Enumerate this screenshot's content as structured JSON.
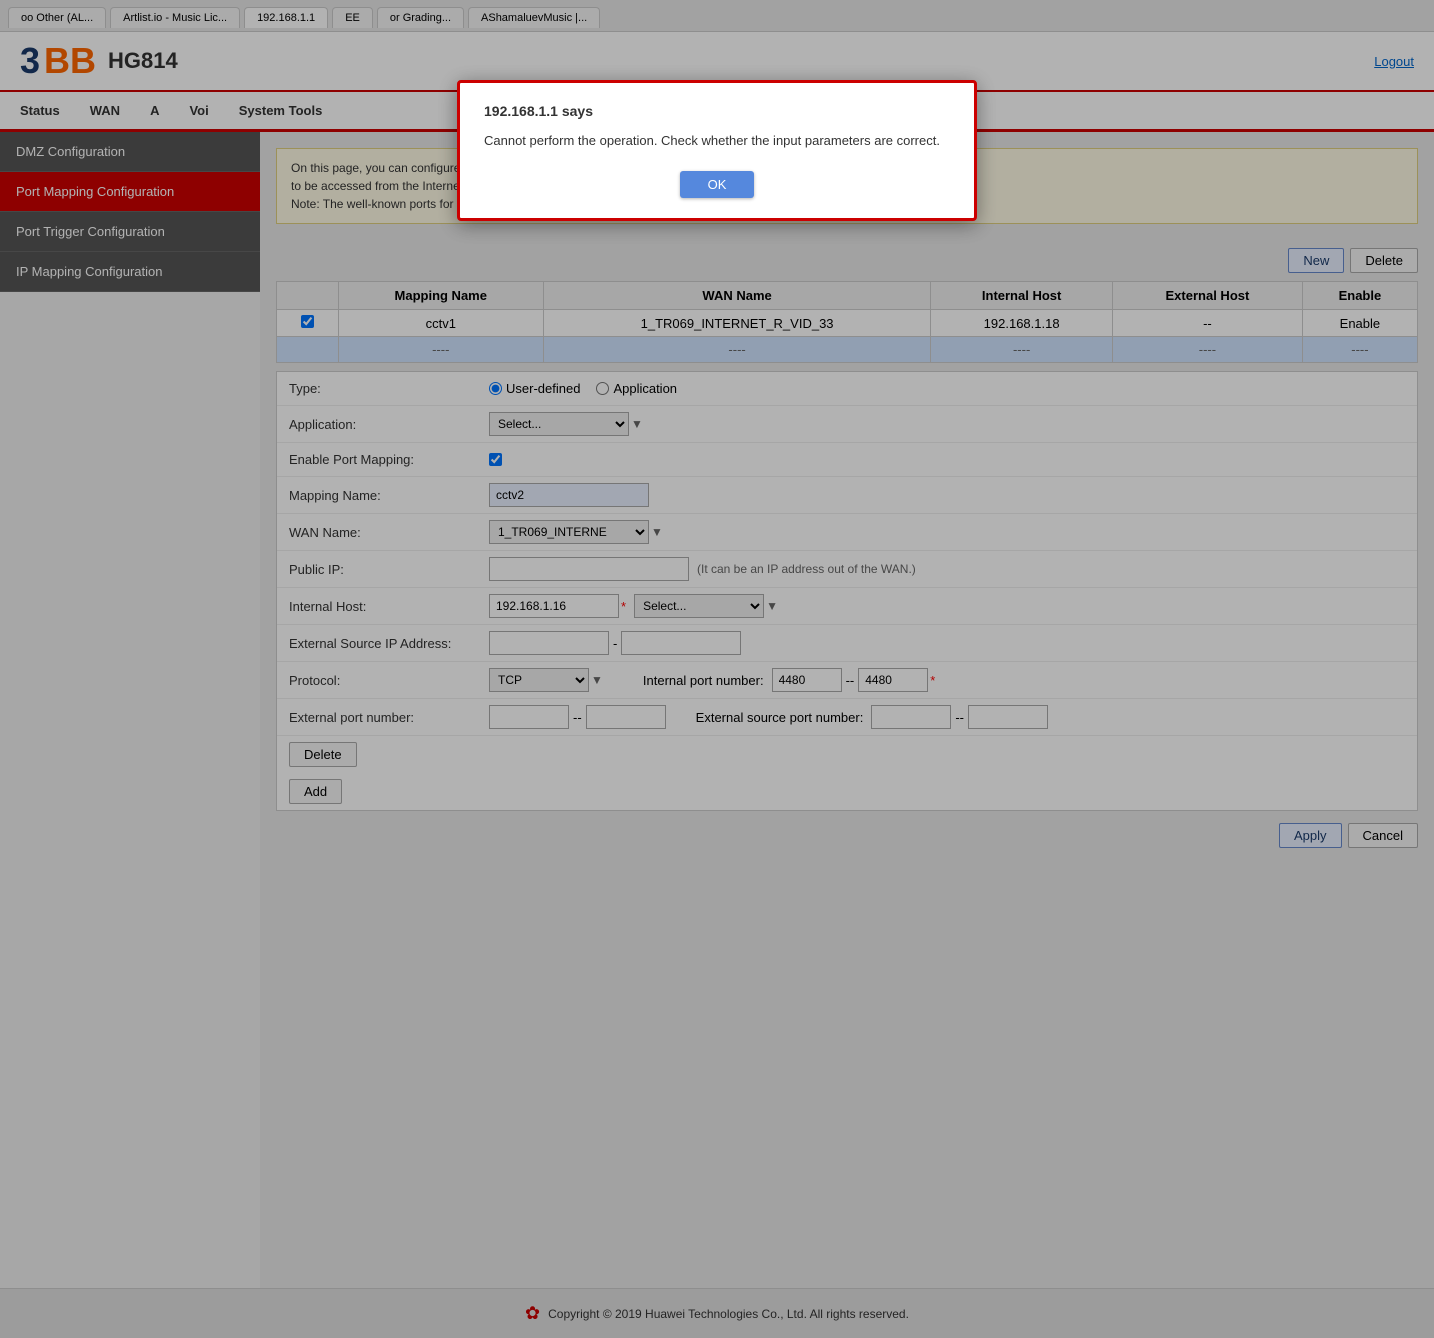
{
  "browser": {
    "tabs": [
      {
        "label": "oo Other (AL...",
        "active": false
      },
      {
        "label": "Artlist.io - Music Lic...",
        "active": false
      },
      {
        "label": "EE",
        "active": false
      },
      {
        "label": "or Grading...",
        "active": false
      },
      {
        "label": "AShamaluevMusic |...",
        "active": false
      }
    ]
  },
  "header": {
    "logo_number": "3",
    "logo_bb": "BB",
    "model": "HG814",
    "logout_label": "Logout"
  },
  "nav": {
    "items": [
      "Status",
      "WAN",
      "A",
      "Voi",
      "System Tools"
    ]
  },
  "sidebar": {
    "items": [
      {
        "label": "DMZ Configuration",
        "active": false
      },
      {
        "label": "Port Mapping Configuration",
        "active": true
      },
      {
        "label": "Port Trigger Configuration",
        "active": false
      },
      {
        "label": "IP Mapping Configuration",
        "active": false
      }
    ]
  },
  "info_box": {
    "line1": "On this page, you can configure port mapping parameters to set up virtual servers on the LAN network and allow these servers",
    "line2": "to be accessed from the Internet.",
    "line3": "Note: The well-known ports for voice services cannot be in the range of the mapping ports."
  },
  "toolbar": {
    "new_label": "New",
    "delete_label": "Delete"
  },
  "table": {
    "headers": [
      "",
      "Mapping Name",
      "WAN Name",
      "Internal Host",
      "External Host",
      "Enable"
    ],
    "rows": [
      {
        "checked": true,
        "mapping_name": "cctv1",
        "wan_name": "1_TR069_INTERNET_R_VID_33",
        "internal_host": "192.168.1.18",
        "external_host": "--",
        "enable": "Enable"
      },
      {
        "checked": false,
        "mapping_name": "----",
        "wan_name": "----",
        "internal_host": "----",
        "external_host": "----",
        "enable": "----",
        "empty": true
      }
    ]
  },
  "form": {
    "type_label": "Type:",
    "type_user_defined": "User-defined",
    "type_application": "Application",
    "application_label": "Application:",
    "application_placeholder": "Select...",
    "enable_label": "Enable Port Mapping:",
    "mapping_name_label": "Mapping Name:",
    "mapping_name_value": "cctv2",
    "wan_name_label": "WAN Name:",
    "wan_name_value": "1_TR069_INTERNE",
    "public_ip_label": "Public IP:",
    "public_ip_hint": "(It can be an IP address out of the WAN.)",
    "internal_host_label": "Internal Host:",
    "internal_host_value": "192.168.1.16",
    "internal_host_select": "Select...",
    "ext_source_ip_label": "External Source IP Address:",
    "protocol_label": "Protocol:",
    "protocol_value": "TCP",
    "internal_port_label": "Internal port number:",
    "internal_port_from": "4480",
    "internal_port_to": "4480",
    "ext_port_label": "External port number:",
    "ext_source_port_label": "External source port number:",
    "delete_btn": "Delete",
    "add_btn": "Add",
    "apply_btn": "Apply",
    "cancel_btn": "Cancel"
  },
  "dialog": {
    "title": "192.168.1.1 says",
    "message": "Cannot perform the operation. Check whether the input parameters are correct.",
    "ok_label": "OK"
  },
  "footer": {
    "text": "Copyright © 2019 Huawei Technologies Co., Ltd. All rights reserved."
  }
}
